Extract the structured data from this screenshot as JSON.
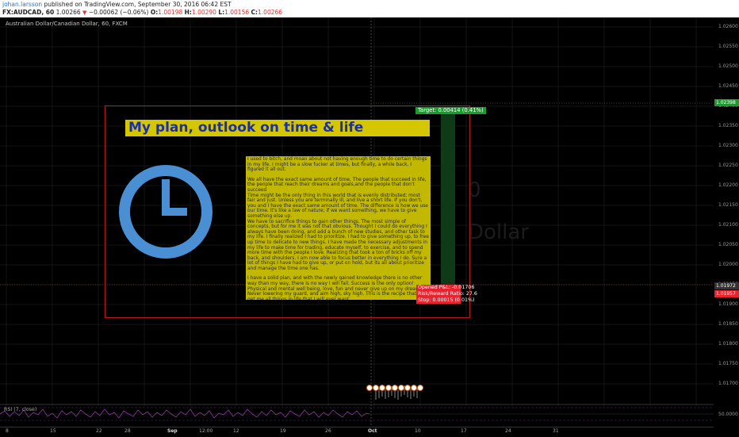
{
  "header": {
    "author": "johan.larsson",
    "published_text": "published on TradingView.com, September 30, 2016 06:42 EST",
    "symbol": "FX:AUDCAD, 60",
    "last": "1.00266",
    "change": "−0.00062 (−0.06%)",
    "ohlc": {
      "O": "1.00198",
      "H": "1.00290",
      "L": "1.00156",
      "C": "1.00266"
    }
  },
  "chart_title": "Australian Dollar/Canadian Dollar, 60, FXCM",
  "yaxis": {
    "ticks": [
      "1.02600",
      "1.02550",
      "1.02500",
      "1.02450",
      "1.02400",
      "1.02350",
      "1.02300",
      "1.02250",
      "1.02200",
      "1.02150",
      "1.02100",
      "1.02050",
      "1.02000",
      "1.01950",
      "1.01900",
      "1.01850",
      "1.01800",
      "1.01750",
      "1.01700"
    ],
    "price_labels": {
      "target": "1.02398",
      "current": "1.01972",
      "stop": "1.01957"
    },
    "rsi_value": "50.0000"
  },
  "xaxis": {
    "ticks": [
      "8",
      "15",
      "22",
      "28",
      "Sep",
      "12:00",
      "12",
      "19",
      "26",
      "Oct",
      "10",
      "17",
      "24",
      "31"
    ]
  },
  "idea": {
    "title": "My plan, outlook on time & life",
    "paragraphs": [
      "I used to bitch, and moan about not having enough time to do certain things in my life. I might be a slow fucker at times, but finally, a while back, I figured it all out.",
      "We all have the exact same amount of time. The people that succeed in life, the people that reach their dreams and goals,and the people that don't succeed",
      "Time might be the only thing in this world that is evenly distributed; most fair and just. Unless you are terminally ill, and live a short life. If you don't, you and I have the exact same amount of time. The difference is how we use our time. It's like a law of nature; if we want something, we have to give something else up.",
      "We have to sacrifice things to gain other things. The most simple of concepts, but for me it was not that obvious. Thought I could do everything I always have been doing, and add a bunch of new studies, and other task to my life. I finally realized I had to prioritize. I had to give something up, to free up time to delicate to new things. I have made the necessary adjustments in my life to make time for trading, educate myself, to exercise, and to spend more time with the people I love. Realizing that took a ton of bricks off my back, and shoulders. I am now able to focus better in everything I do. Sure a lot of things I have had to give up, or put on hold, but its all about prioritize and manage the time one has.",
      "I have a solid plan, and with the newly gained knowledge there is no other way than my way, there is no way I will fail. Success is the only option!",
      "Physical and mental well being, love, fun and never give up on my dreams. Never lowering my guard, and aim high, sky high. This is the recipe that will get me all things in life that I will ever want."
    ]
  },
  "position": {
    "target_label": "Target: 0.00414 (0.41%)",
    "opened_pnl": "Opened P&L: -0.01706",
    "risk_reward": "Risk/Reward Ratio: 27.6",
    "stop_label": "Stop: 0.00015 (0.01%)"
  },
  "watermark": {
    "line1": "0",
    "line2": "Dollar"
  },
  "rsi": {
    "label": "RSI (7, close)"
  },
  "icons": {
    "clock": "clock-icon"
  },
  "colors": {
    "background": "#000000",
    "box_border": "#b41c1c",
    "title_bg": "#d4c600",
    "title_text": "#1a2fb0",
    "note_bg": "#c2b800",
    "clock": "#4a8fd4",
    "target": "#1a9c2c",
    "stop": "#e8232f",
    "rsi_line": "#8a3aa0"
  }
}
